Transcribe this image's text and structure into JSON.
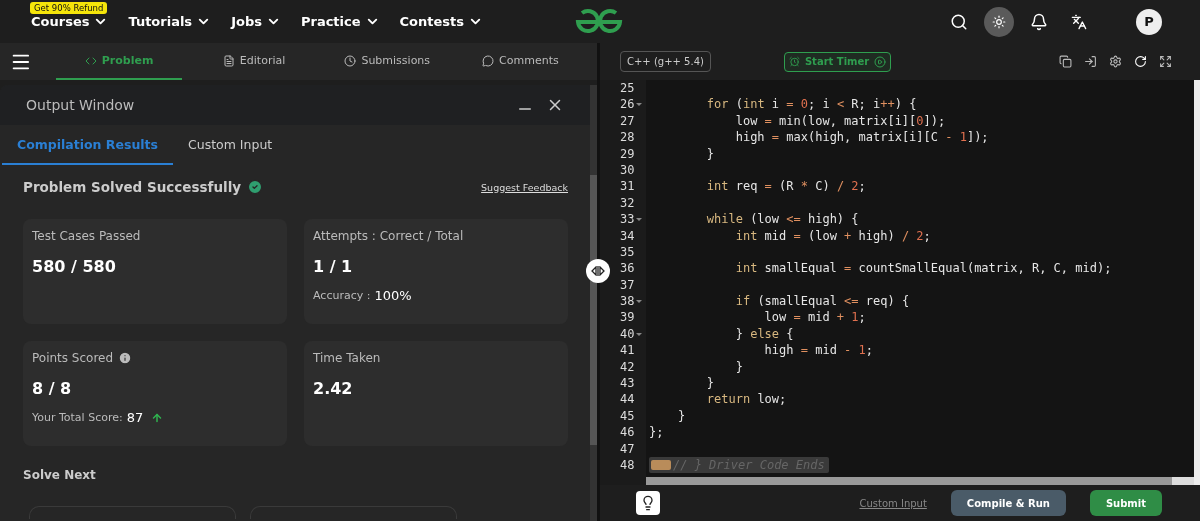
{
  "top_nav": {
    "badge": "Get 90% Refund",
    "items": [
      {
        "label": "Courses"
      },
      {
        "label": "Tutorials"
      },
      {
        "label": "Jobs"
      },
      {
        "label": "Practice"
      },
      {
        "label": "Contests"
      }
    ],
    "avatar": "P"
  },
  "problem_tabs": [
    {
      "label": "Problem",
      "selected": true
    },
    {
      "label": "Editorial",
      "selected": false
    },
    {
      "label": "Submissions",
      "selected": false
    },
    {
      "label": "Comments",
      "selected": false
    }
  ],
  "output_window": {
    "title": "Output Window",
    "tabs": [
      {
        "label": "Compilation Results",
        "selected": true
      },
      {
        "label": "Custom Input",
        "selected": false
      }
    ],
    "status": "Problem Solved Successfully",
    "feedback_link": "Suggest Feedback",
    "cards": [
      {
        "label": "Test Cases Passed",
        "value": "580 / 580"
      },
      {
        "label": "Attempts : Correct / Total",
        "value": "1 / 1",
        "detail": {
          "label": "Accuracy :",
          "value": "100%"
        }
      },
      {
        "label": "Points Scored",
        "info": true,
        "value": "8 / 8",
        "detail": {
          "label": "Your Total Score:",
          "value": "87",
          "rising": true
        }
      },
      {
        "label": "Time Taken",
        "value": "2.42"
      }
    ],
    "solve_next": "Solve Next"
  },
  "editor": {
    "language": "C++ (g++ 5.4)",
    "timer_button": "Start Timer",
    "lines": [
      {
        "number": "25",
        "fold": false
      },
      {
        "number": "26",
        "fold": true,
        "tokens": [
          {
            "kind": "keyword",
            "text": "        for"
          },
          {
            "kind": "plain",
            "text": " ("
          },
          {
            "kind": "keyword",
            "text": "int"
          },
          {
            "kind": "plain",
            "text": " i "
          },
          {
            "kind": "operator",
            "text": "= "
          },
          {
            "kind": "number",
            "text": "0"
          },
          {
            "kind": "plain",
            "text": "; i "
          },
          {
            "kind": "operator",
            "text": "<"
          },
          {
            "kind": "plain",
            "text": " R; i"
          },
          {
            "kind": "operator",
            "text": "++"
          },
          {
            "kind": "plain",
            "text": ") {"
          }
        ]
      },
      {
        "number": "27",
        "fold": false,
        "tokens": [
          {
            "kind": "plain",
            "text": "            low "
          },
          {
            "kind": "operator",
            "text": "="
          },
          {
            "kind": "plain",
            "text": " min(low, matrix[i]["
          },
          {
            "kind": "number",
            "text": "0"
          },
          {
            "kind": "plain",
            "text": "]);"
          }
        ]
      },
      {
        "number": "28",
        "fold": false,
        "tokens": [
          {
            "kind": "plain",
            "text": "            high "
          },
          {
            "kind": "operator",
            "text": "="
          },
          {
            "kind": "plain",
            "text": " max(high, matrix[i][C "
          },
          {
            "kind": "operator",
            "text": "- "
          },
          {
            "kind": "number",
            "text": "1"
          },
          {
            "kind": "plain",
            "text": "]);"
          }
        ]
      },
      {
        "number": "29",
        "fold": false,
        "tokens": [
          {
            "kind": "plain",
            "text": "        }"
          }
        ]
      },
      {
        "number": "30",
        "fold": false
      },
      {
        "number": "31",
        "fold": false,
        "tokens": [
          {
            "kind": "keyword",
            "text": "        int"
          },
          {
            "kind": "plain",
            "text": " req "
          },
          {
            "kind": "operator",
            "text": "="
          },
          {
            "kind": "plain",
            "text": " (R "
          },
          {
            "kind": "operator",
            "text": "*"
          },
          {
            "kind": "plain",
            "text": " C) "
          },
          {
            "kind": "operator",
            "text": "/ "
          },
          {
            "kind": "number",
            "text": "2"
          },
          {
            "kind": "plain",
            "text": ";"
          }
        ]
      },
      {
        "number": "32",
        "fold": false
      },
      {
        "number": "33",
        "fold": true,
        "tokens": [
          {
            "kind": "keyword",
            "text": "        while"
          },
          {
            "kind": "plain",
            "text": " (low "
          },
          {
            "kind": "operator",
            "text": "<="
          },
          {
            "kind": "plain",
            "text": " high) {"
          }
        ]
      },
      {
        "number": "34",
        "fold": false,
        "tokens": [
          {
            "kind": "keyword",
            "text": "            int"
          },
          {
            "kind": "plain",
            "text": " mid "
          },
          {
            "kind": "operator",
            "text": "="
          },
          {
            "kind": "plain",
            "text": " (low "
          },
          {
            "kind": "operator",
            "text": "+"
          },
          {
            "kind": "plain",
            "text": " high) "
          },
          {
            "kind": "operator",
            "text": "/ "
          },
          {
            "kind": "number",
            "text": "2"
          },
          {
            "kind": "plain",
            "text": ";"
          }
        ]
      },
      {
        "number": "35",
        "fold": false
      },
      {
        "number": "36",
        "fold": false,
        "tokens": [
          {
            "kind": "keyword",
            "text": "            int"
          },
          {
            "kind": "plain",
            "text": " smallEqual "
          },
          {
            "kind": "operator",
            "text": "="
          },
          {
            "kind": "plain",
            "text": " countSmallEqual(matrix, R, C, mid);"
          }
        ]
      },
      {
        "number": "37",
        "fold": false
      },
      {
        "number": "38",
        "fold": true,
        "tokens": [
          {
            "kind": "keyword",
            "text": "            if"
          },
          {
            "kind": "plain",
            "text": " (smallEqual "
          },
          {
            "kind": "operator",
            "text": "<="
          },
          {
            "kind": "plain",
            "text": " req) {"
          }
        ]
      },
      {
        "number": "39",
        "fold": false,
        "tokens": [
          {
            "kind": "plain",
            "text": "                low "
          },
          {
            "kind": "operator",
            "text": "="
          },
          {
            "kind": "plain",
            "text": " mid "
          },
          {
            "kind": "operator",
            "text": "+ "
          },
          {
            "kind": "number",
            "text": "1"
          },
          {
            "kind": "plain",
            "text": ";"
          }
        ]
      },
      {
        "number": "40",
        "fold": true,
        "tokens": [
          {
            "kind": "plain",
            "text": "            } "
          },
          {
            "kind": "keyword",
            "text": "else"
          },
          {
            "kind": "plain",
            "text": " {"
          }
        ]
      },
      {
        "number": "41",
        "fold": false,
        "tokens": [
          {
            "kind": "plain",
            "text": "                high "
          },
          {
            "kind": "operator",
            "text": "="
          },
          {
            "kind": "plain",
            "text": " mid "
          },
          {
            "kind": "operator",
            "text": "- "
          },
          {
            "kind": "number",
            "text": "1"
          },
          {
            "kind": "plain",
            "text": ";"
          }
        ]
      },
      {
        "number": "42",
        "fold": false,
        "tokens": [
          {
            "kind": "plain",
            "text": "            }"
          }
        ]
      },
      {
        "number": "43",
        "fold": false,
        "tokens": [
          {
            "kind": "plain",
            "text": "        }"
          }
        ]
      },
      {
        "number": "44",
        "fold": false,
        "tokens": [
          {
            "kind": "keyword",
            "text": "        return"
          },
          {
            "kind": "plain",
            "text": " low;"
          }
        ]
      },
      {
        "number": "45",
        "fold": false,
        "tokens": [
          {
            "kind": "plain",
            "text": "    }"
          }
        ]
      },
      {
        "number": "46",
        "fold": false,
        "tokens": [
          {
            "kind": "plain",
            "text": "};"
          }
        ]
      },
      {
        "number": "47",
        "fold": false
      },
      {
        "number": "48",
        "fold": false,
        "folded": true,
        "tokens": [
          {
            "kind": "comment",
            "text": "// } Driver Code Ends"
          }
        ]
      }
    ],
    "custom_input_link": "Custom Input",
    "compile_button": "Compile & Run",
    "submit_button": "Submit"
  }
}
